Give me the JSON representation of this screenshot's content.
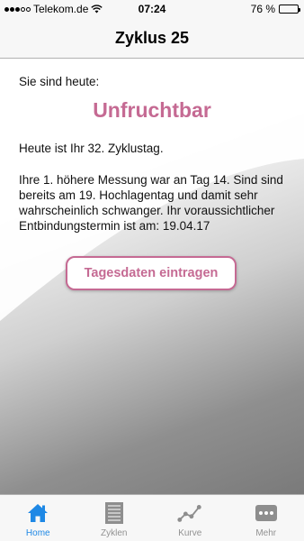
{
  "status_bar": {
    "carrier": "Telekom.de",
    "time": "07:24",
    "battery_percent": "76 %",
    "battery_level": 0.76
  },
  "nav": {
    "title": "Zyklus 25"
  },
  "main": {
    "intro": "Sie sind heute:",
    "status": "Unfruchtbar",
    "cycle_day_text": "Heute ist Ihr 32. Zyklustag.",
    "message": "Ihre 1. höhere Messung war an Tag 14. Sind sind bereits am 19. Hochlagentag und damit sehr wahrscheinlich schwanger. Ihr voraussichtlicher Entbindungstermin ist am: 19.04.17",
    "button_label": "Tagesdaten eintragen"
  },
  "colors": {
    "accent": "#c56a93",
    "tab_active": "#1e88e5",
    "tab_inactive": "#929292"
  },
  "tabs": [
    {
      "label": "Home",
      "icon": "home-icon",
      "active": true
    },
    {
      "label": "Zyklen",
      "icon": "list-icon",
      "active": false
    },
    {
      "label": "Kurve",
      "icon": "chart-icon",
      "active": false
    },
    {
      "label": "Mehr",
      "icon": "more-icon",
      "active": false
    }
  ]
}
